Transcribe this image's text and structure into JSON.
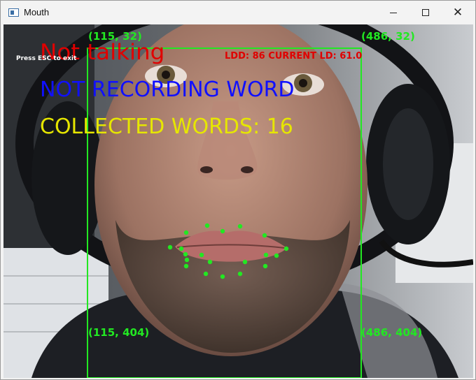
{
  "window": {
    "title": "Mouth",
    "controls": {
      "minimize": "minimize",
      "maximize": "maximize",
      "close": "✕"
    }
  },
  "overlay": {
    "status_text": "Not talking",
    "esc_hint": "Press ESC to exit",
    "ld_readout": "LDD: 86 CURRENT LD: 61.0",
    "recording_text": "NOT RECORDING WORD",
    "collected_text": "COLLECTED WORDS: 16",
    "bbox_labels": {
      "top_left": "(115, 32)",
      "top_right": "(486, 32)",
      "bottom_left": "(115, 404)",
      "bottom_right": "(486, 404)"
    },
    "landmark_count": 20
  },
  "colors": {
    "status_red": "#e00000",
    "recording_blue": "#1010ff",
    "collected_yellow": "#e6e600",
    "landmark_green": "#22e822"
  },
  "icons": {
    "app": "app-window-icon",
    "minimize": "minimize-icon",
    "maximize": "maximize-icon",
    "close": "close-icon"
  }
}
